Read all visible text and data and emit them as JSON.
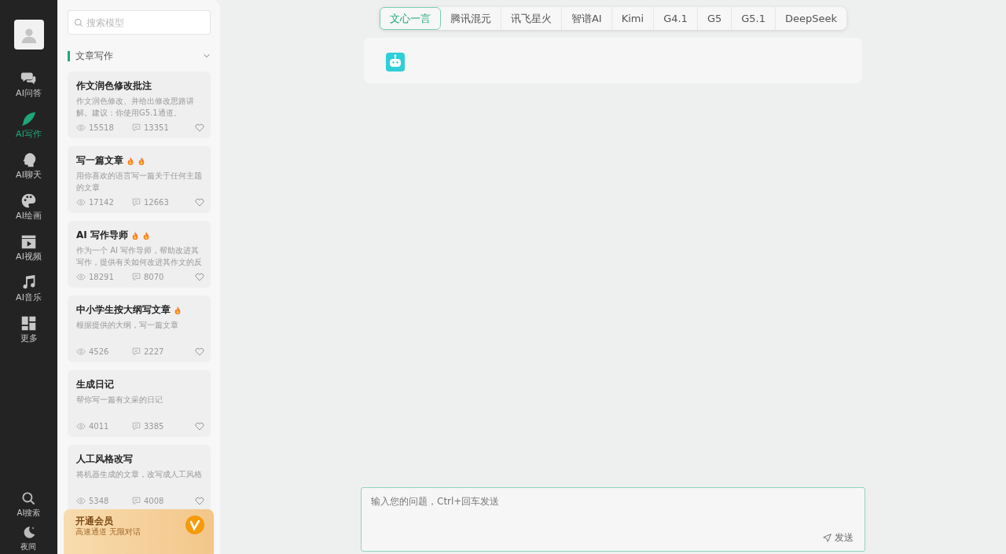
{
  "nav": {
    "items": [
      {
        "label": "AI问答",
        "selected": false
      },
      {
        "label": "AI写作",
        "selected": true
      },
      {
        "label": "AI聊天",
        "selected": false
      },
      {
        "label": "AI绘画",
        "selected": false
      },
      {
        "label": "AI视频",
        "selected": false
      },
      {
        "label": "AI音乐",
        "selected": false
      },
      {
        "label": "更多",
        "selected": false
      }
    ],
    "bottom_items": [
      {
        "label": "AI搜索"
      },
      {
        "label": "夜间"
      }
    ]
  },
  "panel": {
    "search": {
      "placeholder": "搜索模型"
    },
    "section": {
      "title": "文章写作",
      "expanded": true
    },
    "cards": [
      {
        "title": "作文润色修改批注",
        "description": "作文润色修改、并给出修改思路讲解。建议：你使用G5.1通道。",
        "views": "15518",
        "comments": "13351",
        "favorited": false
      },
      {
        "title": "写一篇文章",
        "badges": [
          {
            "kind": "hot"
          },
          {
            "kind": "hot"
          }
        ],
        "description": "用你喜欢的语言写一篇关于任何主题的文章",
        "views": "17142",
        "comments": "12663",
        "favorited": false
      },
      {
        "title": "AI 写作导师",
        "badges": [
          {
            "kind": "hot"
          },
          {
            "kind": "hot"
          }
        ],
        "description": "作为一个 AI 写作导师，帮助改进其写作，提供有关如何改进其作文的反",
        "views": "18291",
        "comments": "8070",
        "favorited": false
      },
      {
        "title": "中小学生按大纲写文章",
        "badges": [
          {
            "kind": "hot"
          }
        ],
        "description": "根据提供的大纲，写一篇文章",
        "views": "4526",
        "comments": "2227",
        "favorited": false
      },
      {
        "title": "生成日记",
        "description": "帮你写一篇有文采的日记",
        "views": "4011",
        "comments": "3385",
        "favorited": false
      },
      {
        "title": "人工风格改写",
        "description": "将机器生成的文章，改写成人工风格",
        "views": "5348",
        "comments": "4008",
        "favorited": false
      }
    ],
    "promo": {
      "title": "开通会员",
      "subtitle": "高速通道 无限对话"
    }
  },
  "model_tabs": [
    {
      "label": "文心一言",
      "selected": true
    },
    {
      "label": "腾讯混元",
      "selected": false
    },
    {
      "label": "讯飞星火",
      "selected": false
    },
    {
      "label": "智谱AI",
      "selected": false
    },
    {
      "label": "Kimi",
      "selected": false
    },
    {
      "label": "G4.1",
      "selected": false
    },
    {
      "label": "G5",
      "selected": false
    },
    {
      "label": "G5.1",
      "selected": false
    },
    {
      "label": "DeepSeek",
      "selected": false
    }
  ],
  "input": {
    "placeholder": "输入您的问题，Ctrl+回车发送",
    "send_label": "发送"
  }
}
